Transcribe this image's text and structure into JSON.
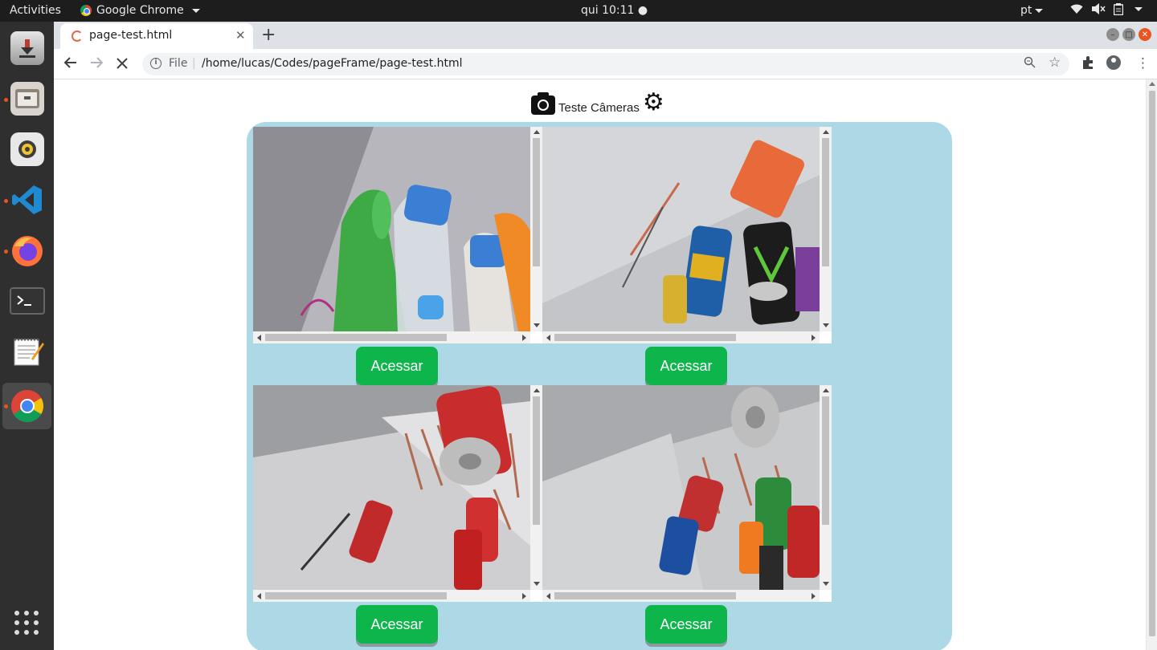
{
  "system": {
    "activities": "Activities",
    "app_name": "Google Chrome",
    "clock": "qui 10:11 ●",
    "language": "pt"
  },
  "browser": {
    "tab_title": "page-test.html",
    "address_scheme": "File",
    "address_url": "/home/lucas/Codes/pageFrame/page-test.html"
  },
  "page": {
    "title": "Teste Câmeras",
    "cameras": [
      {
        "button_label": "Acessar",
        "scene": "bottles"
      },
      {
        "button_label": "Acessar",
        "scene": "energy-cans"
      },
      {
        "button_label": "Acessar",
        "scene": "red-cans"
      },
      {
        "button_label": "Acessar",
        "scene": "mixed-cans"
      }
    ]
  },
  "colors": {
    "panel_bg": "#add8e6",
    "button_bg": "#0db54a",
    "accent": "#e95420"
  }
}
